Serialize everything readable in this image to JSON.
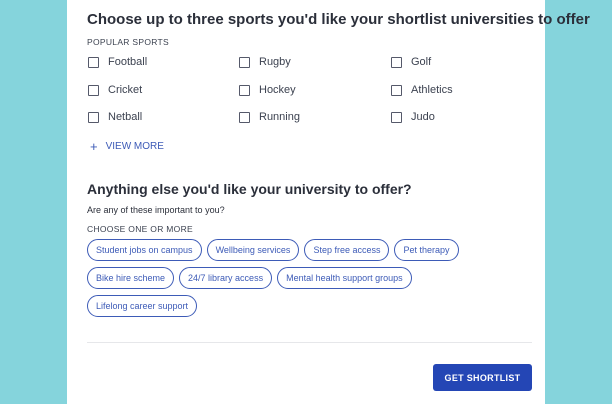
{
  "sports_section": {
    "title": "Choose up to three sports you'd like your shortlist universities to offer",
    "caption": "POPULAR SPORTS",
    "options": [
      {
        "label": "Football"
      },
      {
        "label": "Rugby"
      },
      {
        "label": "Golf"
      },
      {
        "label": "Cricket"
      },
      {
        "label": "Hockey"
      },
      {
        "label": "Athletics"
      },
      {
        "label": "Netball"
      },
      {
        "label": "Running"
      },
      {
        "label": "Judo"
      }
    ],
    "view_more": {
      "icon": "+",
      "label": "VIEW MORE"
    }
  },
  "offer_section": {
    "title": "Anything else you'd like your university to offer?",
    "question": "Are any of these important to you?",
    "caption": "CHOOSE ONE OR MORE",
    "chips": [
      [
        "Student jobs on campus",
        "Wellbeing services",
        "Step free access",
        "Pet therapy"
      ],
      [
        "Bike hire scheme",
        "24/7 library access",
        "Mental health support groups"
      ],
      [
        "Lifelong career support"
      ]
    ]
  },
  "cta": {
    "label": "GET SHORTLIST"
  },
  "colors": {
    "background": "#85d4dc",
    "accent": "#3d5bb7",
    "button": "#2446b5"
  }
}
